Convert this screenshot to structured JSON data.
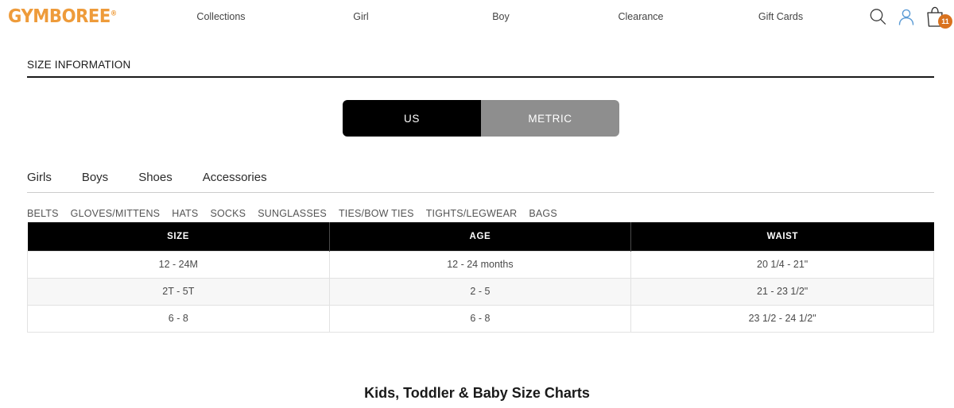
{
  "header": {
    "logo_text": "GYMBOREE",
    "logo_registered": "®",
    "logo_color": "#EE9B3A",
    "nav_items": [
      {
        "label": "Collections"
      },
      {
        "label": "Girl"
      },
      {
        "label": "Boy"
      },
      {
        "label": "Clearance"
      },
      {
        "label": "Gift Cards"
      }
    ],
    "icons": {
      "search": "search-icon",
      "account": "user-icon",
      "account_color": "#5B9BD5",
      "bag": "shopping-bag-icon",
      "bag_badge_count": "11",
      "bag_badge_color": "#D9721E"
    }
  },
  "section": {
    "title": "SIZE INFORMATION"
  },
  "unit_toggle": {
    "options": [
      {
        "label": "US",
        "active": true
      },
      {
        "label": "METRIC",
        "active": false
      }
    ],
    "selected": "US",
    "active_bg": "#000000",
    "inactive_bg": "#8e8e8e"
  },
  "category_tabs": [
    {
      "label": "Girls"
    },
    {
      "label": "Boys"
    },
    {
      "label": "Shoes"
    },
    {
      "label": "Accessories"
    }
  ],
  "subnav": [
    {
      "label": "BELTS"
    },
    {
      "label": "GLOVES/MITTENS"
    },
    {
      "label": "HATS"
    },
    {
      "label": "SOCKS"
    },
    {
      "label": "SUNGLASSES"
    },
    {
      "label": "TIES/BOW TIES"
    },
    {
      "label": "TIGHTS/LEGWEAR"
    },
    {
      "label": "BAGS"
    }
  ],
  "size_table": {
    "columns": [
      "SIZE",
      "AGE",
      "WAIST"
    ],
    "rows": [
      [
        "12 - 24M",
        "12 - 24 months",
        "20 1/4 - 21\""
      ],
      [
        "2T - 5T",
        "2 - 5",
        "21 - 23 1/2\""
      ],
      [
        "6 - 8",
        "6 - 8",
        "23 1/2 - 24 1/2\""
      ]
    ]
  },
  "bottom_heading": "Kids, Toddler & Baby Size Charts"
}
